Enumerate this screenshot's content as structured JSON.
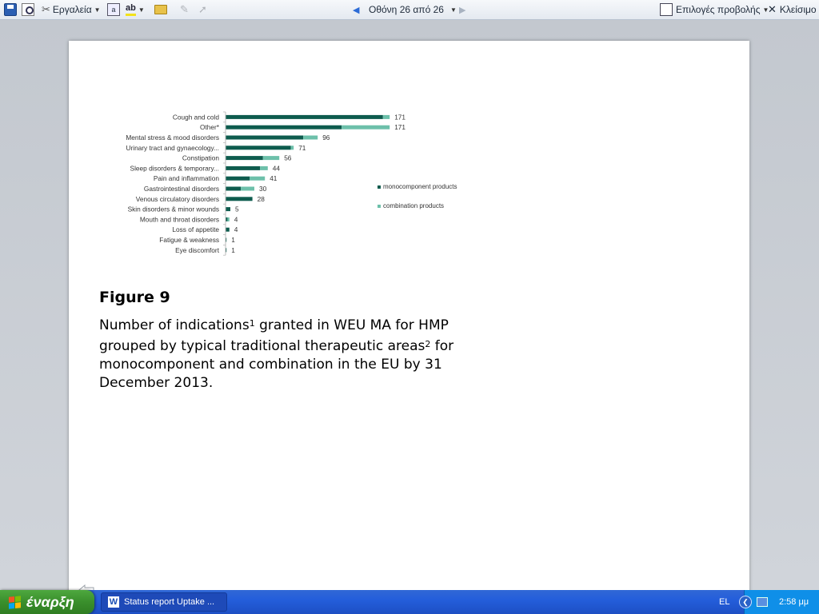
{
  "toolbar": {
    "tools_label": "Εργαλεία",
    "screen_label": "Οθόνη 26 από 26",
    "view_options_label": "Επιλογές προβολής",
    "close_label": "Κλείσιμο"
  },
  "figure": {
    "title": "Figure 9",
    "caption_part1": "Number of indications",
    "caption_sup1": "1",
    "caption_part2": " granted in WEU MA for HMP grouped by typical traditional therapeutic areas",
    "caption_sup2": "2",
    "caption_part3": " for monocomponent and combination in the EU by 31 December 2013."
  },
  "chart_data": {
    "type": "bar",
    "orientation": "horizontal",
    "stacked": true,
    "categories": [
      "Cough and cold",
      "Other*",
      "Mental stress & mood disorders",
      "Urinary tract and gynaecology...",
      "Constipation",
      "Sleep disorders & temporary...",
      "Pain and inflammation",
      "Gastrointestinal disorders",
      "Venous circulatory disorders",
      "Skin disorders & minor wounds",
      "Mouth and throat disorders",
      "Loss of appetite",
      "Fatigue & weakness",
      "Eye discomfort"
    ],
    "totals": [
      171,
      171,
      96,
      71,
      56,
      44,
      41,
      30,
      28,
      5,
      4,
      4,
      1,
      1
    ],
    "series": [
      {
        "name": "monocomponent products",
        "color": "#0e5c4e",
        "values": [
          164,
          121,
          81,
          68,
          39,
          36,
          25,
          16,
          28,
          5,
          2,
          4,
          1,
          1
        ]
      },
      {
        "name": "combination products",
        "color": "#6dc0aa",
        "values": [
          7,
          50,
          15,
          3,
          17,
          8,
          16,
          14,
          0,
          0,
          2,
          0,
          0,
          0
        ]
      }
    ],
    "legend_position": "right",
    "grid": false
  },
  "taskbar": {
    "start_label": "έναρξη",
    "task_label": "Status report Uptake ...",
    "task_icon_letter": "W",
    "language": "EL",
    "clock": "2:58 μμ"
  },
  "colors": {
    "mono": "#0e5c4e",
    "combo": "#6dc0aa"
  }
}
